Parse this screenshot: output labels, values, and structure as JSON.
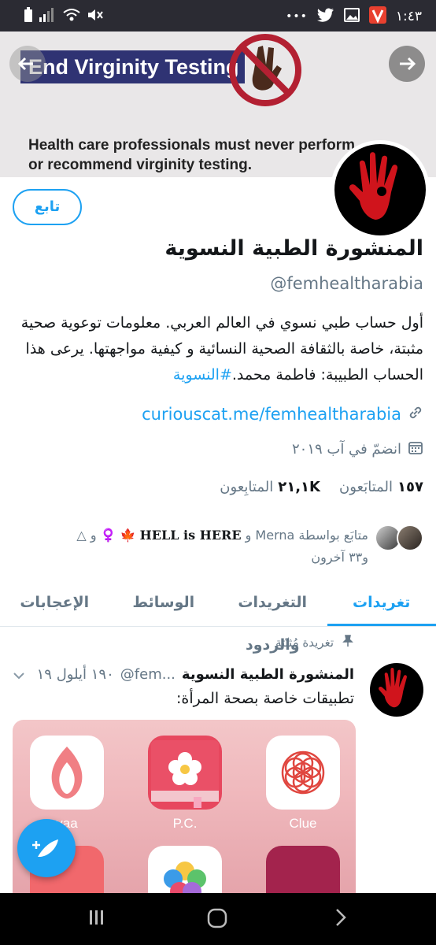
{
  "status_bar": {
    "time": "١:٤٣",
    "more": "•••"
  },
  "banner": {
    "title": "End Virginity Testing",
    "subtitle_line1": "Health care professionals must never perform",
    "subtitle_line2": "or recommend virginity testing."
  },
  "profile": {
    "follow_label": "تابع",
    "name": "المنشورة الطبية النسوية",
    "handle": "@femhealtharabia",
    "bio_text": "أول حساب طبي نسوي في العالم العربي. معلومات توعوية صحية مثبتة، خاصة بالثقافة الصحية النسائية و كيفية مواجهتها. يرعى هذا الحساب الطبيبة: فاطمة محمد.",
    "bio_hashtag": "#النسوية",
    "link": "curiouscat.me/femhealtharabia",
    "joined": "انضمّ في آب ٢٠١٩",
    "following_count": "١٥٧",
    "following_label": "المتابَعون",
    "followers_count": "٢١,١K",
    "followers_label": "المتابِعون",
    "followed_by_prefix": "متابَع بواسطة Merna و",
    "followed_by_bold": "HELL is HERE",
    "followed_by_emojis": "🍁 ♀️",
    "followed_by_suffix": "و △",
    "followed_by_others": "و٣٣ آخرون"
  },
  "tabs": [
    {
      "label": "تغريدات",
      "active": true
    },
    {
      "label": "التغريدات والردود",
      "active": false
    },
    {
      "label": "الوسائط",
      "active": false
    },
    {
      "label": "الإعجابات",
      "active": false
    }
  ],
  "tweet": {
    "pinned_label": "تغريدة مُثبّتة",
    "author": "المنشورة الطبية النسوية",
    "handle": "@fem...",
    "date": "١٩٠ أيلول ١٩",
    "text": "تطبيقات خاصة بصحة المرأة:",
    "apps": [
      {
        "label": "Clue",
        "color": "#e0463f"
      },
      {
        "label": "P.C.",
        "color": "#e7475e"
      },
      {
        "label": "vaa",
        "color": "#f07f84"
      }
    ]
  },
  "colors": {
    "accent": "#1da1f2",
    "muted": "#657786",
    "banner_title_bg": "#2f3373"
  }
}
